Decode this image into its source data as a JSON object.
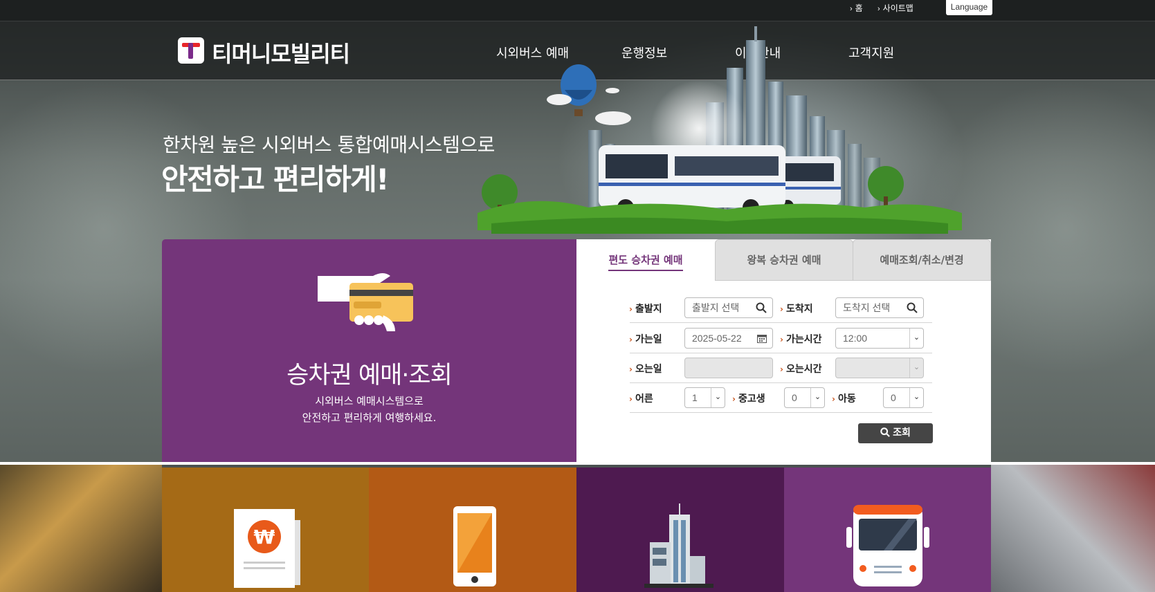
{
  "topbar": {
    "home_label": "홈",
    "sitemap_label": "사이트맵",
    "language_label": "Language"
  },
  "header": {
    "brand": "티머니모빌리티",
    "nav": [
      "시외버스 예매",
      "운행정보",
      "이용안내",
      "고객지원"
    ]
  },
  "hero": {
    "subtitle": "한차원 높은 시외버스 통합예매시스템으로",
    "title": "안전하고 편리하게!"
  },
  "panel": {
    "title": "승차권 예매·조회",
    "desc_line1": "시외버스 예매시스템으로",
    "desc_line2": "안전하고 편리하게 여행하세요."
  },
  "booking": {
    "tabs": [
      "편도 승차권 예매",
      "왕복 승차권 예매",
      "예매조회/취소/변경"
    ],
    "departure_label": "출발지",
    "departure_placeholder": "출발지 선택",
    "arrival_label": "도착지",
    "arrival_placeholder": "도착지 선택",
    "go_date_label": "가는일",
    "go_date_value": "2025-05-22",
    "go_time_label": "가는시간",
    "go_time_value": "12:00",
    "return_date_label": "오는일",
    "return_time_label": "오는시간",
    "adult_label": "어른",
    "adult_value": "1",
    "youth_label": "중고생",
    "youth_value": "0",
    "child_label": "아동",
    "child_value": "0",
    "search_label": "조회"
  },
  "colors": {
    "brand_purple": "#74357a",
    "tile_mustard": "#a56a16",
    "tile_orange": "#b35a15",
    "tile_dark_purple": "#4e1a50",
    "tile_purple": "#74357a",
    "accent_orange": "#c8531b"
  }
}
